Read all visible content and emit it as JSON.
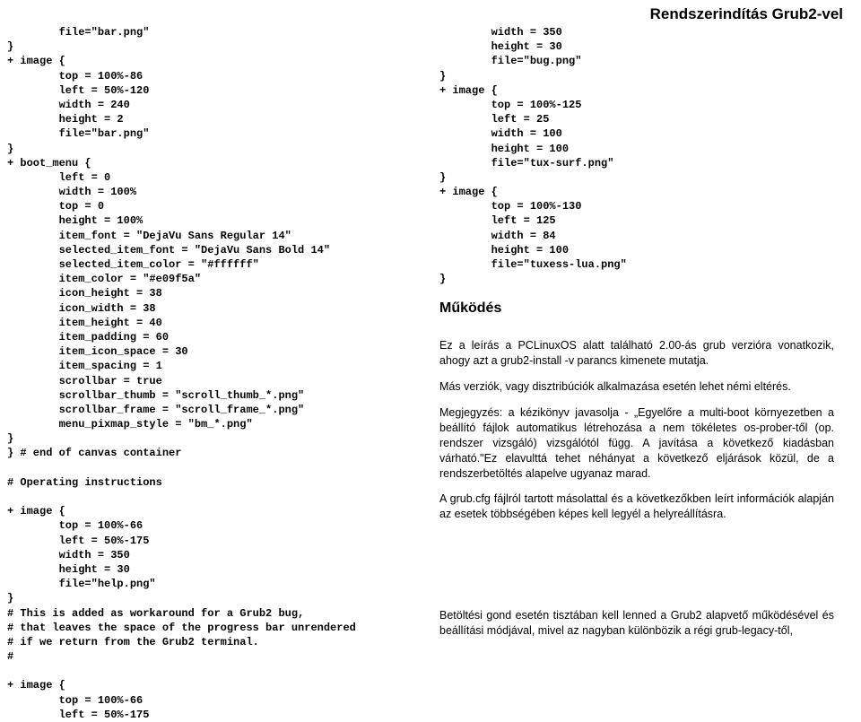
{
  "header": {
    "title": "Rendszerindítás Grub2-vel"
  },
  "left_code": "        file=\"bar.png\"\n}\n+ image {\n        top = 100%-86\n        left = 50%-120\n        width = 240\n        height = 2\n        file=\"bar.png\"\n}\n+ boot_menu {\n        left = 0\n        width = 100%\n        top = 0\n        height = 100%\n        item_font = \"DejaVu Sans Regular 14\"\n        selected_item_font = \"DejaVu Sans Bold 14\"\n        selected_item_color = \"#ffffff\"\n        item_color = \"#e09f5a\"\n        icon_height = 38\n        icon_width = 38\n        item_height = 40\n        item_padding = 60\n        item_icon_space = 30\n        item_spacing = 1\n        scrollbar = true\n        scrollbar_thumb = \"scroll_thumb_*.png\"\n        scrollbar_frame = \"scroll_frame_*.png\"\n        menu_pixmap_style = \"bm_*.png\"\n}\n} # end of canvas container\n\n# Operating instructions\n\n+ image {\n        top = 100%-66\n        left = 50%-175\n        width = 350\n        height = 30\n        file=\"help.png\"\n}\n# This is added as workaround for a Grub2 bug,\n# that leaves the space of the progress bar unrendered\n# if we return from the Grub2 terminal.\n#\n\n+ image {\n        top = 100%-66\n        left = 50%-175",
  "right_code": "        width = 350\n        height = 30\n        file=\"bug.png\"\n}\n+ image {\n        top = 100%-125\n        left = 25\n        width = 100\n        height = 100\n        file=\"tux-surf.png\"\n}\n+ image {\n        top = 100%-130\n        left = 125\n        width = 84\n        height = 100\n        file=\"tuxess-lua.png\"\n}",
  "section_heading": "Működés",
  "paragraphs": {
    "p1": "Ez a leírás a PCLinuxOS alatt található 2.00-ás grub verzióra vonatkozik, ahogy azt a grub2-install -v parancs kimenete mutatja.",
    "p2": "Más verziók, vagy disztribúciók alkalmazása esetén lehet némi eltérés.",
    "p3": "Megjegyzés: a kézikönyv javasolja - „Egyelőre a multi-boot környezetben a beállító fájlok automatikus létrehozása a nem tökéletes os-prober-től (op. rendszer vizsgáló) vizsgálótól függ. A javítása a következő kiadásban várható.\"Ez elavulttá tehet néhányat a következő eljárások közül, de a rendszerbetöltés alapelve ugyanaz marad.",
    "p4": "A grub.cfg fájlról tartott másolattal és a következőkben leírt információk alapján az esetek többségében képes kell legyél a helyreállításra.",
    "bottom": "Betöltési gond esetén tisztában kell lenned a Grub2 alapvető működésével és beállítási módjával, mivel az nagyban különbözik a régi grub-legacy-től,"
  }
}
